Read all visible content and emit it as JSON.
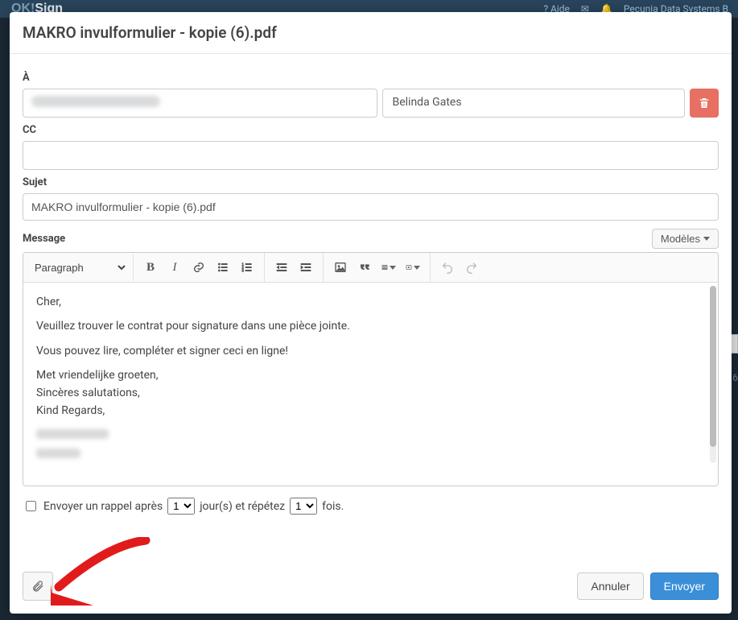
{
  "topbar": {
    "brand_a": "OK!",
    "brand_b": "Sign",
    "help": "Aide",
    "account": "Pecunia Data Systems B"
  },
  "modal": {
    "title": "MAKRO invulformulier - kopie (6).pdf",
    "labels": {
      "to": "À",
      "cc": "CC",
      "subject": "Sujet",
      "message": "Message"
    },
    "to_name": "Belinda Gates",
    "subject_value": "MAKRO invulformulier - kopie (6).pdf",
    "models_btn": "Modèles",
    "format": "Paragraph",
    "body": {
      "greeting": "Cher,",
      "line1": "Veuillez trouver le contrat pour signature dans une pièce jointe.",
      "line2": "Vous pouvez lire, compléter et signer ceci en ligne!",
      "sig1": "Met vriendelijke groeten,",
      "sig2": "Sincères salutations,",
      "sig3": "Kind Regards,"
    },
    "reminder": {
      "prefix": "Envoyer un rappel après",
      "days_value": "1",
      "mid": "jour(s) et répétez",
      "times_value": "1",
      "suffix": "fois."
    },
    "buttons": {
      "cancel": "Annuler",
      "send": "Envoyer"
    }
  },
  "edge_num": "6"
}
